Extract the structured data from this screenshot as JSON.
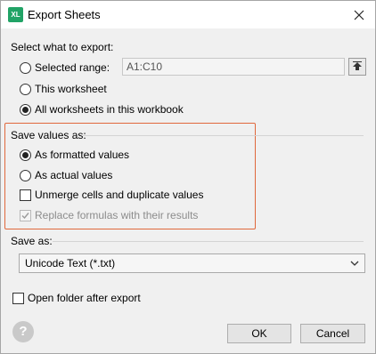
{
  "window": {
    "title": "Export Sheets",
    "app_icon_text": "XL",
    "close_icon": "close-icon"
  },
  "export_section": {
    "heading": "Select what to export:",
    "options": [
      {
        "label": "Selected range:",
        "checked": false
      },
      {
        "label": "This worksheet",
        "checked": false
      },
      {
        "label": "All worksheets in this workbook",
        "checked": true
      }
    ],
    "range_value": "A1:C10",
    "range_button_icon": "collapse-up-icon"
  },
  "values_section": {
    "heading": "Save values as:",
    "options": [
      {
        "label": "As formatted values",
        "checked": true
      },
      {
        "label": "As actual values",
        "checked": false
      }
    ],
    "unmerge_label": "Unmerge cells and duplicate values",
    "unmerge_checked": false,
    "replace_label": "Replace formulas with their results",
    "replace_checked": true,
    "replace_disabled": true,
    "highlight_color": "#e0683c"
  },
  "save_as_section": {
    "heading": "Save as:",
    "format_value": "Unicode Text (*.txt)"
  },
  "open_folder_label": "Open folder after export",
  "open_folder_checked": false,
  "buttons": {
    "help_label": "?",
    "ok_label": "OK",
    "cancel_label": "Cancel"
  }
}
